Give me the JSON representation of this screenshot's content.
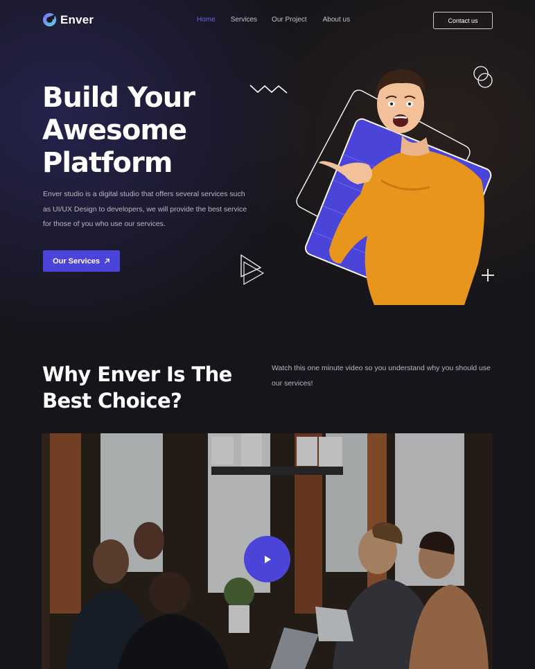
{
  "brand": {
    "name": "Enver"
  },
  "nav": {
    "links": [
      "Home",
      "Services",
      "Our Project",
      "About us"
    ],
    "active": "Home",
    "contact_label": "Contact us"
  },
  "hero": {
    "title_lines": [
      "Build Your",
      "Awesome",
      "Platform"
    ],
    "description": "Enver studio is a digital studio that offers several services such as UI/UX Design to developers, we will provide the best service for those of you who use our services.",
    "cta_label": "Our Services",
    "cta_icon": "arrow-up-right-icon"
  },
  "why": {
    "title_lines": [
      "Why Enver Is The",
      "Best Choice?"
    ],
    "description": "Watch this one minute video so you understand why you should use our services!",
    "video_icon": "play-icon"
  },
  "colors": {
    "accent": "#4b44d9",
    "nav_active": "#6a63ee",
    "background": "#16151b",
    "shirt": "#e8951e"
  }
}
